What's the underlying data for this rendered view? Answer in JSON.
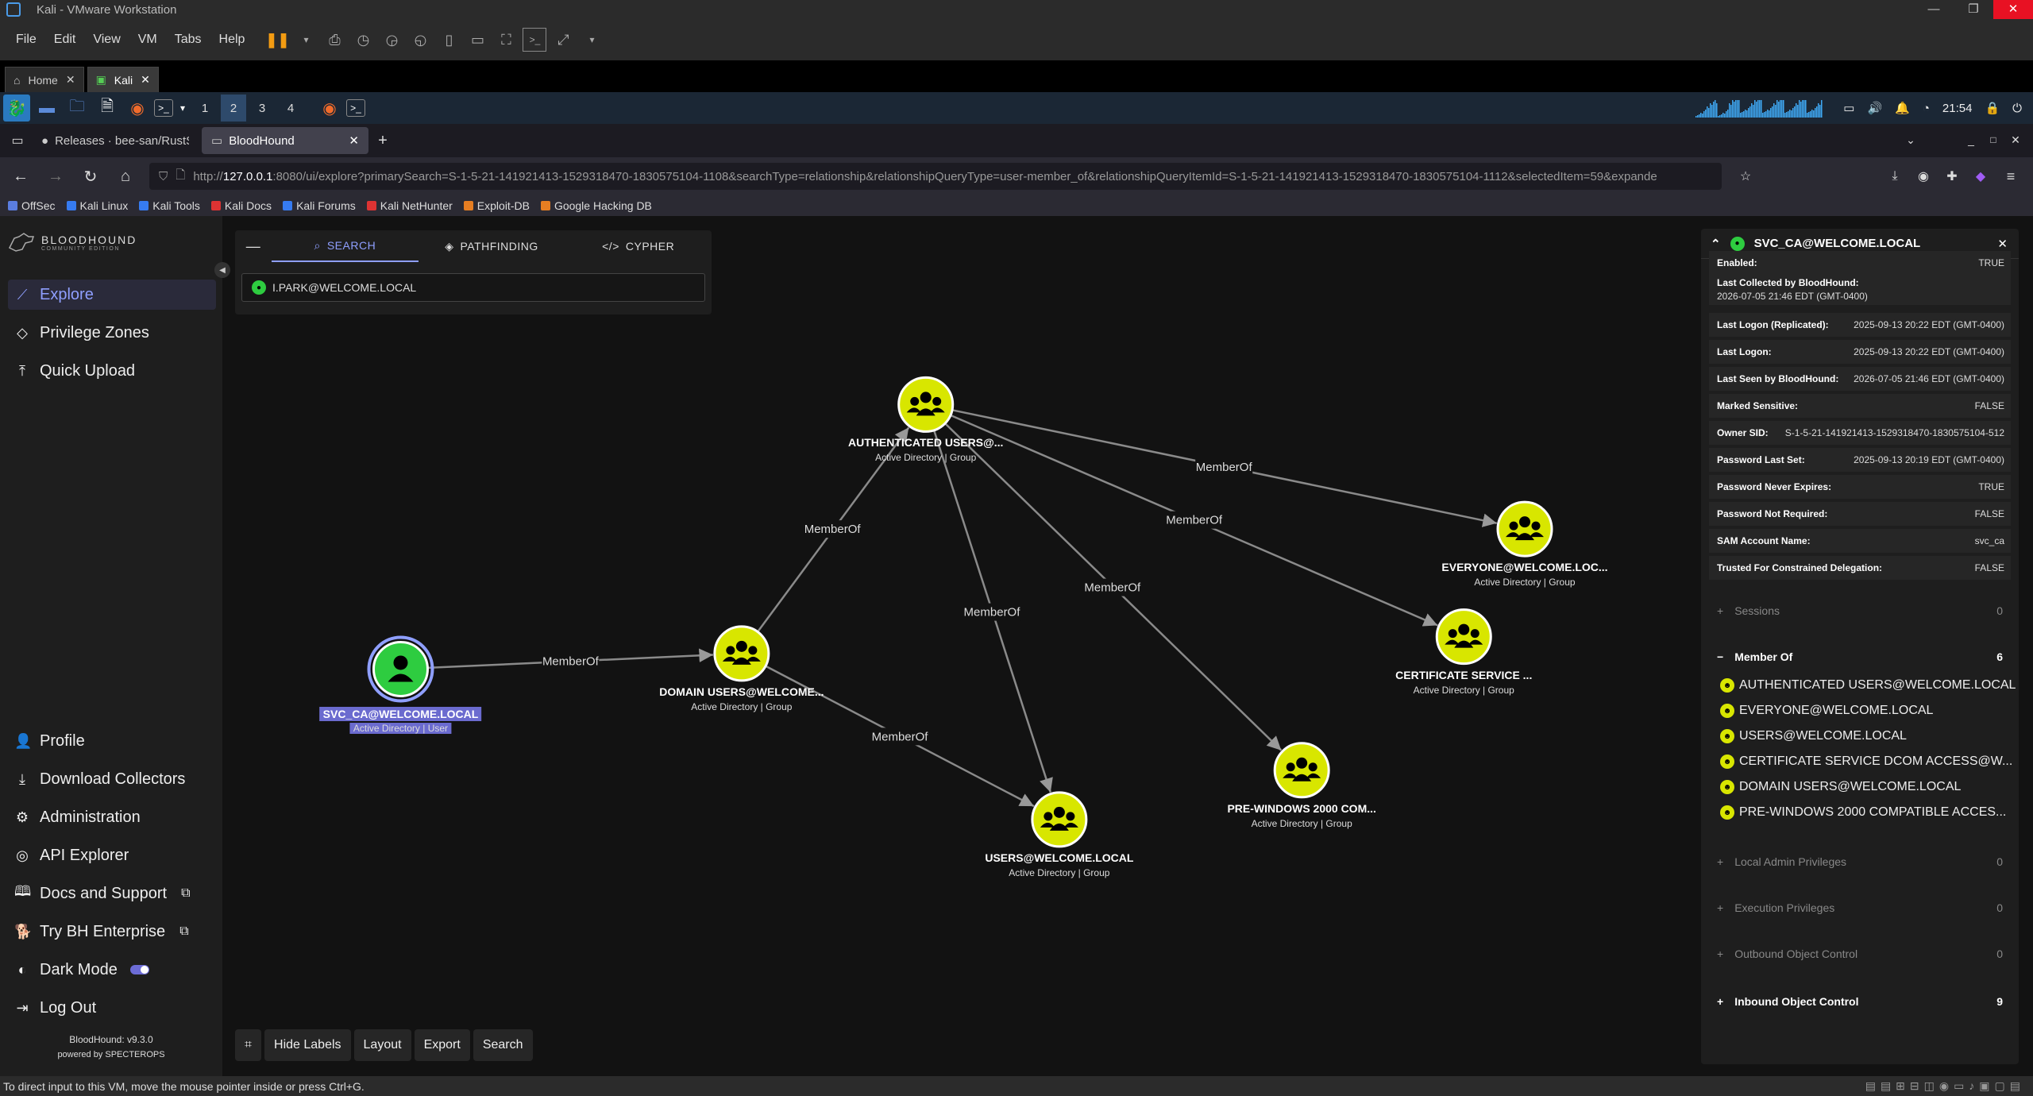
{
  "vmware": {
    "title": "Kali - VMware Workstation",
    "menu": [
      "File",
      "Edit",
      "View",
      "VM",
      "Tabs",
      "Help"
    ],
    "tabs": [
      {
        "label": "Home"
      },
      {
        "label": "Kali"
      }
    ]
  },
  "kali_panel": {
    "workspaces": [
      "1",
      "2",
      "3",
      "4"
    ],
    "clock": "21:54"
  },
  "browser": {
    "tabs": [
      {
        "label": "Releases · bee-san/RustS"
      },
      {
        "label": "BloodHound"
      }
    ],
    "url_prefix": "http://",
    "url_host": "127.0.0.1",
    "url_rest": ":8080/ui/explore?primarySearch=S-1-5-21-141921413-1529318470-1830575104-1108&searchType=relationship&relationshipQueryType=user-member_of&relationshipQueryItemId=S-1-5-21-141921413-1529318470-1830575104-1112&selectedItem=59&expande",
    "bookmarks": [
      "OffSec",
      "Kali Linux",
      "Kali Tools",
      "Kali Docs",
      "Kali Forums",
      "Kali NetHunter",
      "Exploit-DB",
      "Google Hacking DB"
    ]
  },
  "sidebar": {
    "logo": "BLOODHOUND",
    "logo_sub": "COMMUNITY EDITION",
    "top_items": [
      "Explore",
      "Privilege Zones",
      "Quick Upload"
    ],
    "bottom_items": [
      "Profile",
      "Download Collectors",
      "Administration",
      "API Explorer",
      "Docs and Support",
      "Try BH Enterprise",
      "Dark Mode",
      "Log Out"
    ],
    "version": "BloodHound: v9.3.0",
    "powered": "powered by SPECTEROPS"
  },
  "search": {
    "tabs": [
      "SEARCH",
      "PATHFINDING",
      "CYPHER"
    ],
    "value": "I.PARK@WELCOME.LOCAL"
  },
  "graph": {
    "edge_label": "MemberOf",
    "nodes": [
      {
        "label": "SVC_CA@WELCOME.LOCAL",
        "sub": "Active Directory | User"
      },
      {
        "label": "DOMAIN USERS@WELCOME...",
        "sub": "Active Directory | Group"
      },
      {
        "label": "AUTHENTICATED USERS@...",
        "sub": "Active Directory | Group"
      },
      {
        "label": "USERS@WELCOME.LOCAL",
        "sub": "Active Directory | Group"
      },
      {
        "label": "PRE-WINDOWS 2000 COM...",
        "sub": "Active Directory | Group"
      },
      {
        "label": "CERTIFICATE SERVICE ...",
        "sub": "Active Directory | Group"
      },
      {
        "label": "EVERYONE@WELCOME.LOC...",
        "sub": "Active Directory | Group"
      }
    ]
  },
  "toolbar": [
    "Hide Labels",
    "Layout",
    "Export",
    "Search"
  ],
  "entity": {
    "title": "SVC_CA@WELCOME.LOCAL",
    "props": [
      {
        "k": "Enabled:",
        "v": "TRUE"
      },
      {
        "k": "Last Collected by BloodHound:",
        "v": "2026-07-05 21:46 EDT (GMT-0400)"
      },
      {
        "k": "Last Logon (Replicated):",
        "v": "2025-09-13 20:22 EDT (GMT-0400)"
      },
      {
        "k": "Last Logon:",
        "v": "2025-09-13 20:22 EDT (GMT-0400)"
      },
      {
        "k": "Last Seen by BloodHound:",
        "v": "2026-07-05 21:46 EDT (GMT-0400)"
      },
      {
        "k": "Marked Sensitive:",
        "v": "FALSE"
      },
      {
        "k": "Owner SID:",
        "v": "S-1-5-21-141921413-1529318470-1830575104-512"
      },
      {
        "k": "Password Last Set:",
        "v": "2025-09-13 20:19 EDT (GMT-0400)"
      },
      {
        "k": "Password Never Expires:",
        "v": "TRUE"
      },
      {
        "k": "Password Not Required:",
        "v": "FALSE"
      },
      {
        "k": "SAM Account Name:",
        "v": "svc_ca"
      },
      {
        "k": "Trusted For Constrained Delegation:",
        "v": "FALSE"
      }
    ],
    "sessions": {
      "label": "Sessions",
      "count": "0"
    },
    "member_of": {
      "label": "Member Of",
      "count": "6",
      "items": [
        "AUTHENTICATED USERS@WELCOME.LOCAL",
        "EVERYONE@WELCOME.LOCAL",
        "USERS@WELCOME.LOCAL",
        "CERTIFICATE SERVICE DCOM ACCESS@W...",
        "DOMAIN USERS@WELCOME.LOCAL",
        "PRE-WINDOWS 2000 COMPATIBLE ACCES..."
      ]
    },
    "sections": [
      {
        "label": "Local Admin Privileges",
        "count": "0"
      },
      {
        "label": "Execution Privileges",
        "count": "0"
      },
      {
        "label": "Outbound Object Control",
        "count": "0"
      },
      {
        "label": "Inbound Object Control",
        "count": "9"
      }
    ]
  },
  "statusbar": "To direct input to this VM, move the mouse pointer inside or press Ctrl+G.",
  "colors": {
    "accent": "#8f9fff",
    "group_node": "#d8e600",
    "user_node": "#2ecc40"
  }
}
